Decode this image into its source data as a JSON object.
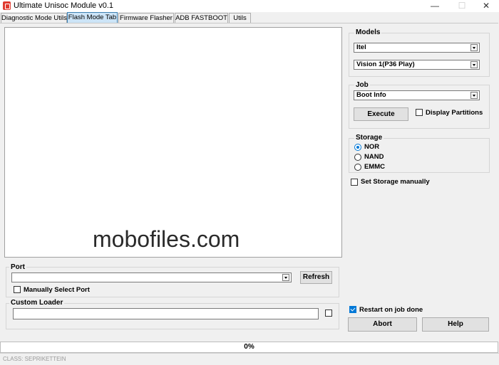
{
  "window": {
    "title": "Ultimate Unisoc Module v0.1",
    "minimize_glyph": "—",
    "maximize_glyph": "☐",
    "close_glyph": "✕"
  },
  "tabs": [
    {
      "label": "Diagnostic  Mode Utils",
      "active": false
    },
    {
      "label": "Flash Mode Tab",
      "active": true
    },
    {
      "label": "Firmware Flasher",
      "active": false
    },
    {
      "label": "ADB FASTBOOT",
      "active": false
    },
    {
      "label": "Utils",
      "active": false
    }
  ],
  "log": {
    "watermark": "mobofiles.com"
  },
  "models": {
    "label": "Models",
    "brand_selected": "Itel",
    "model_selected": "Vision 1(P36 Play)"
  },
  "job": {
    "label": "Job",
    "selected": "Boot Info",
    "execute_label": "Execute",
    "display_partitions_label": "Display Partitions",
    "display_partitions_checked": false
  },
  "storage": {
    "label": "Storage",
    "options": [
      "NOR",
      "NAND",
      "EMMC"
    ],
    "selected": "NOR",
    "set_manually_label": "Set Storage manually",
    "set_manually_checked": false
  },
  "port": {
    "label": "Port",
    "value": "",
    "refresh_label": "Refresh",
    "manual_label": "Manually Select Port",
    "manual_checked": false
  },
  "loader": {
    "label": "Custom Loader",
    "value": "",
    "checked": false
  },
  "actions": {
    "restart_label": "Restart on job done",
    "restart_checked": true,
    "abort_label": "Abort",
    "help_label": "Help"
  },
  "progress": {
    "text": "0%",
    "value": 0
  },
  "status": {
    "text": "CLASS: SEPRIKETTEIN"
  },
  "colors": {
    "accent": "#0078d7",
    "active_tab": "#cce4f7",
    "app_icon": "#e03c31"
  }
}
